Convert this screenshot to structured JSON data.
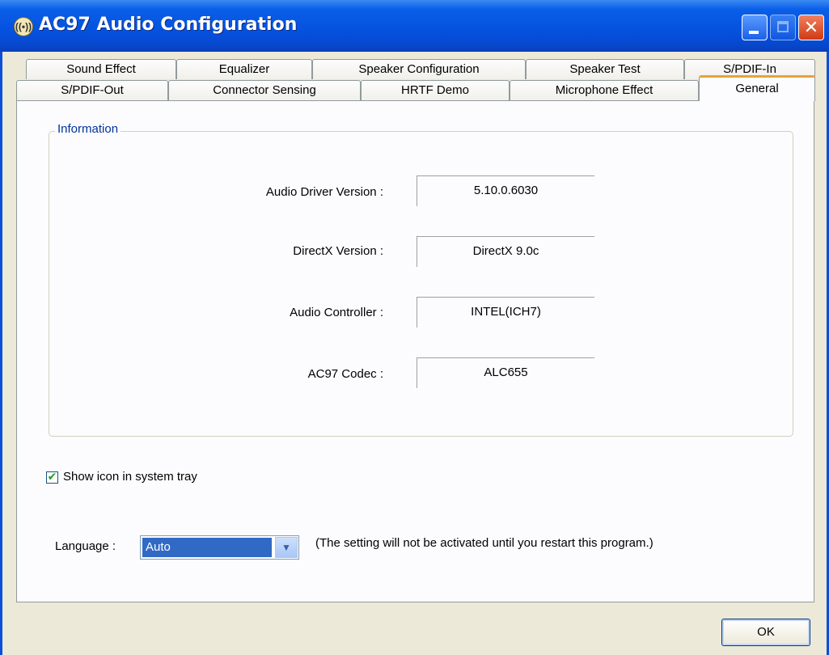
{
  "window": {
    "title": "AC97 Audio Configuration",
    "icon": "speaker-icon",
    "accent_color": "#0553e0"
  },
  "tabs_row1": [
    {
      "label": "Sound Effect"
    },
    {
      "label": "Equalizer"
    },
    {
      "label": "Speaker Configuration"
    },
    {
      "label": "Speaker Test"
    },
    {
      "label": "S/PDIF-In"
    }
  ],
  "tabs_row2": [
    {
      "label": "S/PDIF-Out"
    },
    {
      "label": "Connector Sensing"
    },
    {
      "label": "HRTF Demo"
    },
    {
      "label": "Microphone Effect"
    },
    {
      "label": "General",
      "active": true
    }
  ],
  "information": {
    "title": "Information",
    "rows": [
      {
        "label": "Audio Driver Version :",
        "value": "5.10.0.6030"
      },
      {
        "label": "DirectX Version :",
        "value": "DirectX 9.0c"
      },
      {
        "label": "Audio Controller :",
        "value": "INTEL(ICH7)"
      },
      {
        "label": "AC97 Codec :",
        "value": "ALC655"
      }
    ]
  },
  "tray": {
    "label": "Show icon in system tray",
    "checked": true
  },
  "language": {
    "label": "Language :",
    "selected": "Auto",
    "note": "(The setting will not be activated until you restart this program.)"
  },
  "ok_label": "OK"
}
